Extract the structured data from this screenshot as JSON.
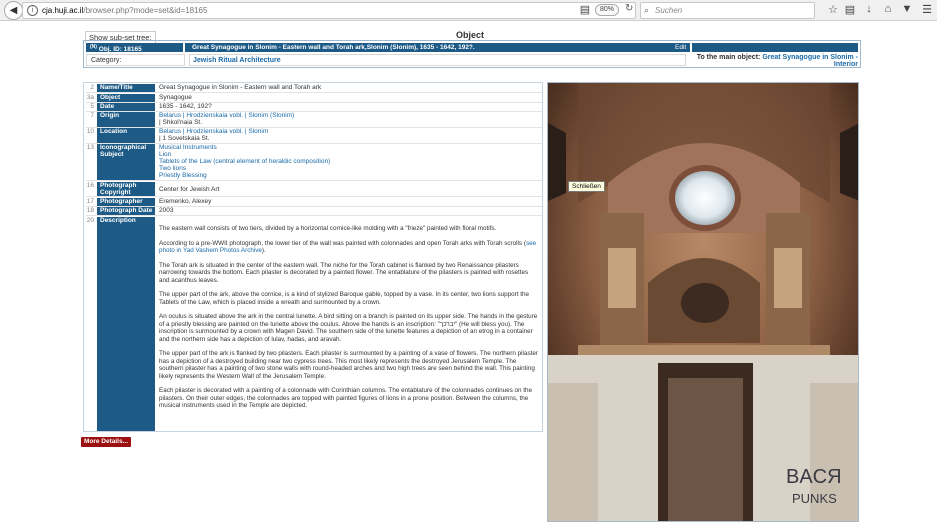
{
  "browser": {
    "url_host": "cja.huji.ac.il",
    "url_path": "/browser.php?mode=set&id=18165",
    "zoom": "80%",
    "search_placeholder": "Suchen"
  },
  "page": {
    "subtree_label": "Show sub-set tree:",
    "title": "Object"
  },
  "header": {
    "obj_id": "Obj. ID: 18165",
    "obj_id_prefix": "(N)",
    "obj_name": "Great Synagogue in Slonim - Eastern wall and Torah ark,Slonim (Slonim), 1635 - 1642, 192?.",
    "edit_label": "Edit",
    "category_label": "Category:",
    "category_value": "Jewish Ritual Architecture",
    "main_object_label": "To the main object:",
    "main_object_link": "Great Synagogue in Slonim - Interior"
  },
  "details": {
    "rows": [
      {
        "num": "2",
        "label": "Name/Title",
        "value": "Great Synagogue in Slonim - Eastern wall and Torah ark"
      },
      {
        "num": "3a",
        "label": "Object",
        "value": "Synagogue"
      },
      {
        "num": "5",
        "label": "Date",
        "value": "1635 - 1642, 192?"
      },
      {
        "num": "7",
        "label": "Origin",
        "value": "Belarus | Hrodzienskaia vobl. | Slonim (Slonim)",
        "value2": "| Shkol'naia St."
      },
      {
        "num": "10",
        "label": "Location",
        "value": "Belarus | Hrodzienskaia vobl. | Slonim",
        "value2": "| 1 Sovetskaia St."
      },
      {
        "num": "13",
        "label": "Iconographical Subject",
        "items": [
          "Musical Instruments",
          "Lion",
          "Tablets of the Law (central element of heraldic composition)",
          "Two lions",
          "Priestly Blessing"
        ]
      },
      {
        "num": "16",
        "label": "Photograph Copyright",
        "value": "Center for Jewish Art"
      },
      {
        "num": "17",
        "label": "Photographer",
        "value": "Eremenko, Alexey"
      },
      {
        "num": "18",
        "label": "Photograph Date",
        "value": "2003"
      },
      {
        "num": "20",
        "label": "Description"
      }
    ],
    "description": [
      "The eastern wall consists of two tiers, divided by a horizontal cornice-like molding with a \"frieze\" painted with floral motifs.",
      "According to a pre-WWII photograph, the lower tier of the wall was painted with colonnades and open Torah arks with Torah scrolls",
      "The Torah ark is situated in the center of the eastern wall. The niche for the Torah cabinet is flanked by two Renaissance pilasters narrowing towards the bottom. Each pilaster is decorated by a painted flower. The entablature of the pilasters is painted with rosettes and acanthus leaves.",
      "The upper part of the ark, above the cornice, is a kind of stylized Baroque gable, topped by a vase. In its center, two lions support the Tablets of the Law, which is placed inside a wreath and surmounted by a crown.",
      "An oculus is situated above the ark in the central lunette. A bird sitting on a branch is painted on its upper side. The hands in the gesture of a priestly blessing are painted on the lunette above the oculus. Above the hands is an inscription: \"יברכך\" (He will bless you). The inscription is surmounted by a crown with Magen David. The southern side of the lunette features a depiction of an etrog in a container and the northern side has a depiction of lulav, hadas, and aravah.",
      "The upper part of the ark is flanked by two pilasters. Each pilaster is surmounted by a painting of a vase of flowers. The northern pilaster has a depiction of a destroyed building near two cypress trees. This most likely represents the destroyed Jerusalem Temple. The southern pilaster has a painting of two stone walls with round-headed arches and two high trees are seen behind the wall. This painting likely represents the Western Wall of the Jerusalem Temple.",
      "Each pilaster is decorated with a painting of a colonnade with Corinthian columns. The entablature of the colonnades continues on the pilasters. On their outer edges, the colonnades are topped with painted figures of lions in a prone position. Between the columns, the musical instruments used in the Temple are depicted."
    ],
    "desc_link": "see photo in Yad Vashem Photos Archive"
  },
  "more_details_label": "More Details...",
  "photo": {
    "tooltip": "Schließen",
    "graffiti_line1": "BACЯ",
    "graffiti_line2": "PUNKS"
  }
}
